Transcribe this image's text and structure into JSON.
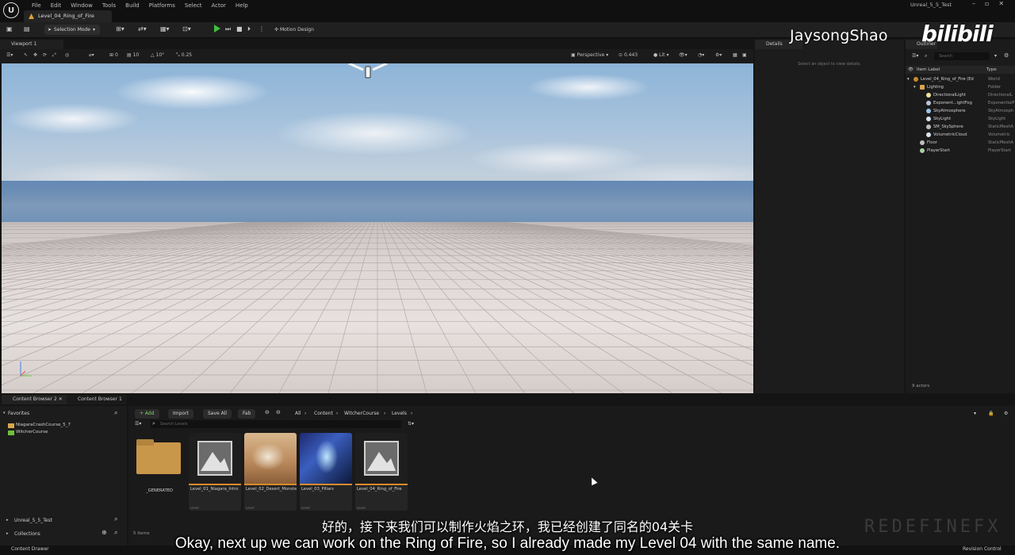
{
  "menubar": {
    "items": [
      "File",
      "Edit",
      "Window",
      "Tools",
      "Build",
      "Platforms",
      "Select",
      "Actor",
      "Help"
    ],
    "level_tab": "Level_04_Ring_of_Fire",
    "project_name": "Unreal_5_5_Test",
    "win_controls": [
      "–",
      "▫",
      "✕"
    ]
  },
  "toolbar": {
    "selection_mode": "Selection Mode",
    "motion_design": "Motion Design"
  },
  "viewport": {
    "tab_label": "Viewport 1",
    "perspective": "Perspective",
    "speed": "0.443",
    "lit": "Lit",
    "snap_translate": "10",
    "snap_rotate": "10°",
    "snap_scale": "0.25",
    "grid": "0"
  },
  "details": {
    "tab_label": "Details",
    "empty_text": "Select an object to view details."
  },
  "outliner": {
    "tab_label": "Outliner",
    "search_placeholder": "Search",
    "header_label": "Item Label",
    "header_type": "Type",
    "rows": [
      {
        "label": "Level_04_Ring_of_Fire (Ed",
        "type": "World",
        "indent": 0
      },
      {
        "label": "Lighting",
        "type": "Folder",
        "indent": 1
      },
      {
        "label": "DirectionalLight",
        "type": "DirectionalL",
        "indent": 2
      },
      {
        "label": "Exponent...ightFog",
        "type": "ExponentialF",
        "indent": 2
      },
      {
        "label": "SkyAtmosphere",
        "type": "SkyAtmosph",
        "indent": 2
      },
      {
        "label": "SkyLight",
        "type": "SkyLight",
        "indent": 2
      },
      {
        "label": "SM_SkySphere",
        "type": "StaticMeshA",
        "indent": 2
      },
      {
        "label": "VolumetricCloud",
        "type": "Volumetric",
        "indent": 2
      },
      {
        "label": "Floor",
        "type": "StaticMeshA",
        "indent": 1
      },
      {
        "label": "PlayerStart",
        "type": "PlayerStart",
        "indent": 1
      }
    ],
    "actor_count": "9 actors"
  },
  "content_browser": {
    "tabs": [
      "Content Browser 2",
      "Content Browser 1"
    ],
    "favorites_label": "Favorites",
    "favorites": [
      "NiagaraCrashCourse_5_7",
      "WitcherCourse"
    ],
    "unreal_label": "Unreal_5_5_Test",
    "collections_label": "Collections",
    "buttons": {
      "add": "+ Add",
      "import": "Import",
      "save_all": "Save All",
      "fab": "Fab"
    },
    "breadcrumbs": [
      "All",
      "Content",
      "WitcherCourse",
      "Levels"
    ],
    "search_placeholder": "Search Levels",
    "assets": [
      {
        "name": "_GENERATED",
        "kind": "folder",
        "type": ""
      },
      {
        "name": "Level_01_Niagara_Intro",
        "kind": "level",
        "type": "Level"
      },
      {
        "name": "Level_02_Desert_Monster",
        "kind": "desert",
        "type": "Level"
      },
      {
        "name": "Level_03_Pillars",
        "kind": "pillars",
        "type": "Level"
      },
      {
        "name": "Level_04_Ring_of_Fire",
        "kind": "level",
        "type": "Level"
      }
    ],
    "items_count": "5 items"
  },
  "statusbar": {
    "content_drawer": "Content Drawer",
    "revision_control": "Revision Control"
  },
  "overlay": {
    "watermark": "JaysongShao",
    "bili": "bilibili",
    "subtitle_cn": "好的，接下来我们可以制作火焰之环，我已经创建了同名的04关卡",
    "subtitle_en": "Okay, next up we can work on the Ring of Fire, so I already made my Level 04 with the same name.",
    "redefine": "REDEFINEFX"
  }
}
